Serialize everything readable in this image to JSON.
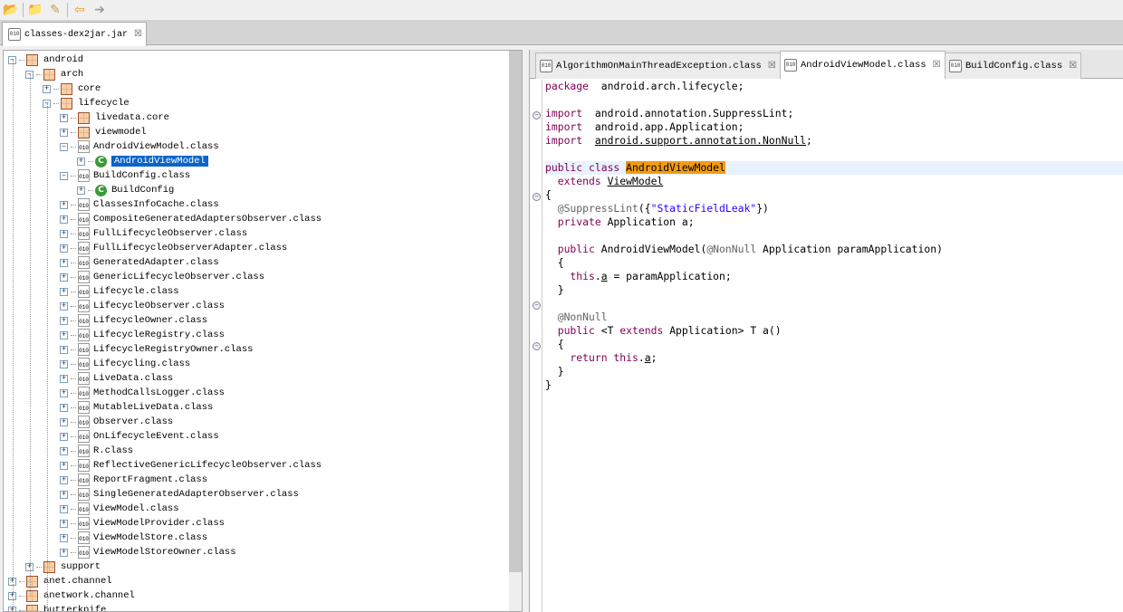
{
  "toolbar": {
    "icons": [
      "open-file-icon",
      "open-type-icon",
      "search-icon",
      "back-icon",
      "forward-icon"
    ]
  },
  "file_tab": {
    "label": "classes-dex2jar.jar"
  },
  "tree": [
    {
      "label": "android",
      "depth": 0,
      "type": "package",
      "state": "expanded"
    },
    {
      "label": "arch",
      "depth": 1,
      "type": "package",
      "state": "expanded"
    },
    {
      "label": "core",
      "depth": 2,
      "type": "package",
      "state": "collapsed"
    },
    {
      "label": "lifecycle",
      "depth": 2,
      "type": "package",
      "state": "expanded"
    },
    {
      "label": "livedata.core",
      "depth": 3,
      "type": "package",
      "state": "collapsed"
    },
    {
      "label": "viewmodel",
      "depth": 3,
      "type": "package",
      "state": "collapsed"
    },
    {
      "label": "AndroidViewModel.class",
      "depth": 3,
      "type": "classfile",
      "state": "expanded"
    },
    {
      "label": "AndroidViewModel",
      "depth": 4,
      "type": "class",
      "state": "collapsed",
      "selected": true
    },
    {
      "label": "BuildConfig.class",
      "depth": 3,
      "type": "classfile",
      "state": "expanded"
    },
    {
      "label": "BuildConfig",
      "depth": 4,
      "type": "class",
      "state": "collapsed"
    },
    {
      "label": "ClassesInfoCache.class",
      "depth": 3,
      "type": "classfile",
      "state": "collapsed"
    },
    {
      "label": "CompositeGeneratedAdaptersObserver.class",
      "depth": 3,
      "type": "classfile",
      "state": "collapsed"
    },
    {
      "label": "FullLifecycleObserver.class",
      "depth": 3,
      "type": "classfile",
      "state": "collapsed"
    },
    {
      "label": "FullLifecycleObserverAdapter.class",
      "depth": 3,
      "type": "classfile",
      "state": "collapsed"
    },
    {
      "label": "GeneratedAdapter.class",
      "depth": 3,
      "type": "classfile",
      "state": "collapsed"
    },
    {
      "label": "GenericLifecycleObserver.class",
      "depth": 3,
      "type": "classfile",
      "state": "collapsed"
    },
    {
      "label": "Lifecycle.class",
      "depth": 3,
      "type": "classfile",
      "state": "collapsed"
    },
    {
      "label": "LifecycleObserver.class",
      "depth": 3,
      "type": "classfile",
      "state": "collapsed"
    },
    {
      "label": "LifecycleOwner.class",
      "depth": 3,
      "type": "classfile",
      "state": "collapsed"
    },
    {
      "label": "LifecycleRegistry.class",
      "depth": 3,
      "type": "classfile",
      "state": "collapsed"
    },
    {
      "label": "LifecycleRegistryOwner.class",
      "depth": 3,
      "type": "classfile",
      "state": "collapsed"
    },
    {
      "label": "Lifecycling.class",
      "depth": 3,
      "type": "classfile",
      "state": "collapsed"
    },
    {
      "label": "LiveData.class",
      "depth": 3,
      "type": "classfile",
      "state": "collapsed"
    },
    {
      "label": "MethodCallsLogger.class",
      "depth": 3,
      "type": "classfile",
      "state": "collapsed"
    },
    {
      "label": "MutableLiveData.class",
      "depth": 3,
      "type": "classfile",
      "state": "collapsed"
    },
    {
      "label": "Observer.class",
      "depth": 3,
      "type": "classfile",
      "state": "collapsed"
    },
    {
      "label": "OnLifecycleEvent.class",
      "depth": 3,
      "type": "classfile",
      "state": "collapsed"
    },
    {
      "label": "R.class",
      "depth": 3,
      "type": "classfile",
      "state": "collapsed"
    },
    {
      "label": "ReflectiveGenericLifecycleObserver.class",
      "depth": 3,
      "type": "classfile",
      "state": "collapsed"
    },
    {
      "label": "ReportFragment.class",
      "depth": 3,
      "type": "classfile",
      "state": "collapsed"
    },
    {
      "label": "SingleGeneratedAdapterObserver.class",
      "depth": 3,
      "type": "classfile",
      "state": "collapsed"
    },
    {
      "label": "ViewModel.class",
      "depth": 3,
      "type": "classfile",
      "state": "collapsed"
    },
    {
      "label": "ViewModelProvider.class",
      "depth": 3,
      "type": "classfile",
      "state": "collapsed"
    },
    {
      "label": "ViewModelStore.class",
      "depth": 3,
      "type": "classfile",
      "state": "collapsed"
    },
    {
      "label": "ViewModelStoreOwner.class",
      "depth": 3,
      "type": "classfile",
      "state": "collapsed"
    },
    {
      "label": "support",
      "depth": 1,
      "type": "package",
      "state": "collapsed"
    },
    {
      "label": "anet.channel",
      "depth": 0,
      "type": "package",
      "state": "collapsed"
    },
    {
      "label": "anetwork.channel",
      "depth": 0,
      "type": "package",
      "state": "collapsed"
    },
    {
      "label": "butterknife",
      "depth": 0,
      "type": "package",
      "state": "collapsed"
    }
  ],
  "editor_tabs": [
    {
      "label": "AlgorithmOnMainThreadException.class",
      "active": false
    },
    {
      "label": "AndroidViewModel.class",
      "active": true
    },
    {
      "label": "BuildConfig.class",
      "active": false
    }
  ],
  "code": [
    [
      [
        "kw",
        "package"
      ],
      [
        "",
        "  android.arch.lifecycle;"
      ]
    ],
    [],
    [
      [
        "kw",
        "import"
      ],
      [
        "",
        "  android.annotation.SuppressLint;"
      ]
    ],
    [
      [
        "kw",
        "import"
      ],
      [
        "",
        "  android.app.Application;"
      ]
    ],
    [
      [
        "kw",
        "import"
      ],
      [
        "",
        "  "
      ],
      [
        "ul",
        "android.support.annotation.NonNull"
      ],
      [
        "",
        ";"
      ]
    ],
    [],
    [
      [
        "kw",
        "public class "
      ],
      [
        "mark",
        "AndroidViewModel"
      ]
    ],
    [
      [
        "",
        "  "
      ],
      [
        "kw",
        "extends "
      ],
      [
        "ul",
        "ViewModel"
      ]
    ],
    [
      [
        "",
        "{"
      ]
    ],
    [
      [
        "ann",
        "  @SuppressLint"
      ],
      [
        "",
        "({"
      ],
      [
        "str",
        "\"StaticFieldLeak\""
      ],
      [
        "",
        "})"
      ]
    ],
    [
      [
        "kw",
        "  private "
      ],
      [
        "",
        "Application a;"
      ]
    ],
    [],
    [
      [
        "kw",
        "  public "
      ],
      [
        "",
        "AndroidViewModel("
      ],
      [
        "ann",
        "@NonNull"
      ],
      [
        "",
        " Application paramApplication)"
      ]
    ],
    [
      [
        "",
        "  {"
      ]
    ],
    [
      [
        "kw",
        "    this"
      ],
      [
        "",
        "."
      ],
      [
        "ul",
        "a"
      ],
      [
        "",
        " = paramApplication;"
      ]
    ],
    [
      [
        "",
        "  }"
      ]
    ],
    [],
    [
      [
        "ann",
        "  @NonNull"
      ]
    ],
    [
      [
        "kw",
        "  public "
      ],
      [
        "",
        "<T "
      ],
      [
        "kw",
        "extends "
      ],
      [
        "",
        "Application> T a()"
      ]
    ],
    [
      [
        "",
        "  {"
      ]
    ],
    [
      [
        "kw",
        "    return this"
      ],
      [
        "",
        "."
      ],
      [
        "ul",
        "a"
      ],
      [
        "",
        ";"
      ]
    ],
    [
      [
        "",
        "  }"
      ]
    ],
    [
      [
        "",
        "}"
      ]
    ]
  ]
}
